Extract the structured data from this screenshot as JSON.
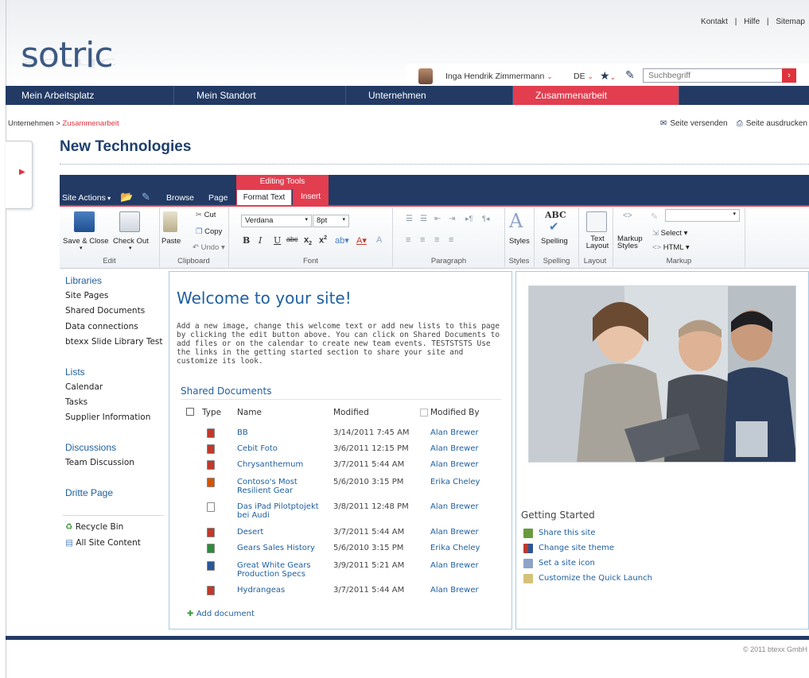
{
  "header": {
    "top_links": [
      "Kontakt",
      "|",
      "Hilfe",
      "|",
      "Sitemap"
    ],
    "logo": "sotric",
    "user_name": "Inga Hendrik Zimmermann",
    "language": "DE",
    "search_placeholder": "Suchbegriff"
  },
  "nav": {
    "items": [
      "Mein Arbeitsplatz",
      "Mein Standort",
      "Unternehmen",
      "Zusammenarbeit"
    ],
    "active": "Zusammenarbeit"
  },
  "breadcrumb": {
    "parent": "Unternehmen",
    "separator": ">",
    "current": "Zusammenarbeit"
  },
  "page_actions": {
    "send": "Seite versenden",
    "print": "Seite ausdrucken"
  },
  "page_title": "New Technologies",
  "ribbon": {
    "site_actions": "Site Actions",
    "tabs": [
      "Browse",
      "Page",
      "Format Text",
      "Insert"
    ],
    "contextual_group": "Editing Tools",
    "edit": {
      "save_close": "Save & Close",
      "check_out": "Check Out",
      "label": "Edit"
    },
    "clipboard": {
      "paste": "Paste",
      "cut": "Cut",
      "copy": "Copy",
      "undo": "Undo",
      "label": "Clipboard"
    },
    "font": {
      "family": "Verdana",
      "size": "8pt",
      "label": "Font"
    },
    "paragraph": {
      "label": "Paragraph"
    },
    "styles": {
      "button": "Styles",
      "label": "Styles"
    },
    "spelling": {
      "button": "Spelling",
      "label": "Spelling"
    },
    "layout": {
      "button": "Text Layout",
      "label": "Layout"
    },
    "markup": {
      "styles": "Markup Styles",
      "select": "Select",
      "html": "HTML",
      "label": "Markup"
    }
  },
  "quick_launch": {
    "libraries": {
      "heading": "Libraries",
      "items": [
        "Site Pages",
        "Shared Documents",
        "Data connections",
        "btexx Slide Library Test"
      ]
    },
    "lists": {
      "heading": "Lists",
      "items": [
        "Calendar",
        "Tasks",
        "Supplier Information"
      ]
    },
    "discussions": {
      "heading": "Discussions",
      "items": [
        "Team Discussion"
      ]
    },
    "dritte": {
      "heading": "Dritte Page"
    },
    "recycle_bin": "Recycle Bin",
    "all_site_content": "All Site Content"
  },
  "welcome": {
    "title": "Welcome to your site!",
    "text": "Add a new image, change this welcome text or add new lists to this page by clicking the edit button above. You can click on Shared Documents to add files or on the calendar to create new team events.  TESTSTSTS Use the links in the getting started section to share your site and customize its look."
  },
  "shared_documents": {
    "title": "Shared Documents",
    "columns": [
      "Type",
      "Name",
      "Modified",
      "Modified By"
    ],
    "rows": [
      {
        "name": "BB",
        "modified": "3/14/2011 7:45 AM",
        "by": "Alan Brewer",
        "color": "#c0392b"
      },
      {
        "name": "Cebit Foto",
        "modified": "3/6/2011 12:15 PM",
        "by": "Alan Brewer",
        "color": "#c0392b"
      },
      {
        "name": "Chrysanthemum",
        "modified": "3/7/2011 5:44 AM",
        "by": "Alan Brewer",
        "color": "#c0392b"
      },
      {
        "name": "Contoso's Most Resilient Gear",
        "modified": "5/6/2010 3:15 PM",
        "by": "Erika Cheley",
        "color": "#d35400"
      },
      {
        "name": "Das iPad Pilotptojekt bei Audi",
        "modified": "3/8/2011 12:48 PM",
        "by": "Alan Brewer",
        "color": "#ffffff"
      },
      {
        "name": "Desert",
        "modified": "3/7/2011 5:44 AM",
        "by": "Alan Brewer",
        "color": "#c0392b"
      },
      {
        "name": "Gears Sales History",
        "modified": "5/6/2010 3:15 PM",
        "by": "Erika Cheley",
        "color": "#2e8b3a"
      },
      {
        "name": "Great White Gears Production Specs",
        "modified": "3/9/2011 5:21 AM",
        "by": "Alan Brewer",
        "color": "#2b5797"
      },
      {
        "name": "Hydrangeas",
        "modified": "3/7/2011 5:44 AM",
        "by": "Alan Brewer",
        "color": "#c0392b"
      }
    ],
    "add_document": "Add document"
  },
  "getting_started": {
    "title": "Getting Started",
    "items": [
      "Share this site",
      "Change site theme",
      "Set a site icon",
      "Customize the Quick Launch"
    ]
  },
  "footer": {
    "copyright": "© 2011 btexx GmbH"
  },
  "colors": {
    "navy": "#223a64",
    "accent_red": "#e23e50",
    "link_blue": "#1f5fa0"
  }
}
